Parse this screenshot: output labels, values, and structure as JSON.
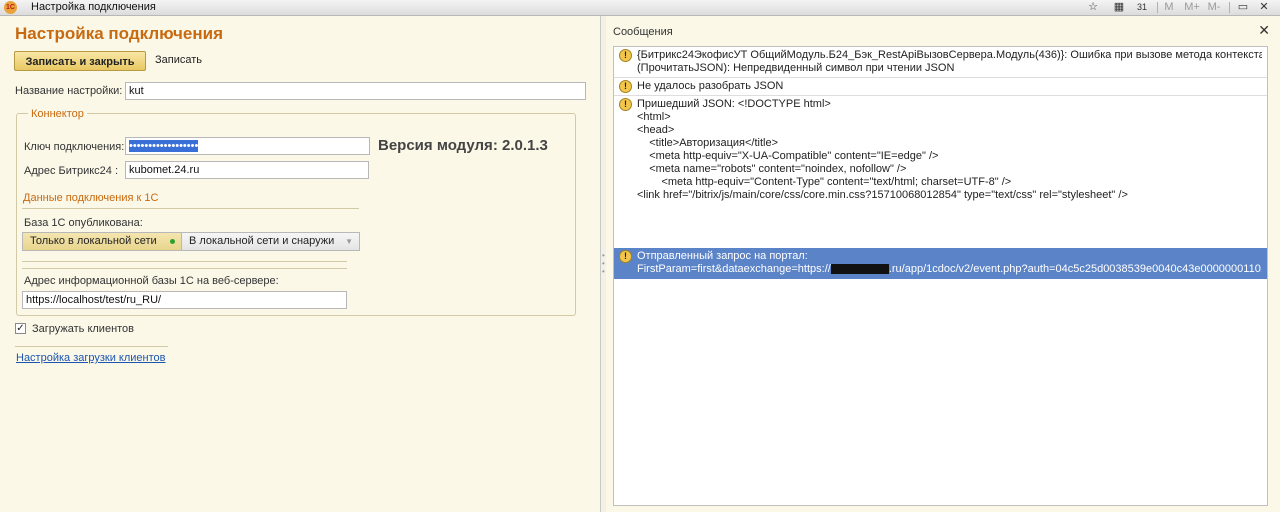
{
  "window": {
    "title": "Настройка подключения",
    "logo_text": "1С",
    "toolbar": [
      "☆",
      "▦",
      "31",
      "M",
      "M+",
      "M-",
      "▭",
      "✕"
    ]
  },
  "form": {
    "title": "Настройка подключения",
    "save_close_label": "Записать и закрыть",
    "save_label": "Записать",
    "name_label": "Название настройки:",
    "name_value": "kut",
    "connector": {
      "title": "Коннектор",
      "key_label": "Ключ подключения:",
      "key_value": "••••••••••••••••••",
      "address_label": "Адрес Битрикс24 :",
      "address_value": "kubomet.24.ru",
      "version": "Версия модуля: 2.0.1.3",
      "onec_section": "Данные подключения к 1С",
      "published_label": "База 1С опубликована:",
      "option_local": "Только в локальной сети",
      "option_both": "В локальной сети и снаружи",
      "web_address_label": "Адрес информационной базы 1С на веб-сервере:",
      "web_address_value": "https://localhost/test/ru_RU/"
    },
    "load_clients_label": "Загружать клиентов",
    "load_clients_checked": true,
    "clients_settings_link": "Настройка загрузки клиентов"
  },
  "messages": {
    "title": "Сообщения",
    "items": [
      {
        "text": "{Битрикс24ЭкофисУТ ОбщийМодуль.Б24_Бэк_RestApiВызовСервера.Модуль(436)}: Ошибка при вызове метода контекста\n(ПрочитатьJSON): Непредвиденный символ при чтении JSON"
      },
      {
        "text": "Не удалось разобрать JSON"
      },
      {
        "text": "Пришедший JSON: <!DOCTYPE html>\n<html>\n<head>\n    <title>Авторизация</title>\n    <meta http-equiv=\"X-UA-Compatible\" content=\"IE=edge\" />\n    <meta name=\"robots\" content=\"noindex, nofollow\" />\n        <meta http-equiv=\"Content-Type\" content=\"text/html; charset=UTF-8\" />\n<link href=\"/bitrix/js/main/core/css/core.min.css?15710068012854\" type=\"text/css\" rel=\"stylesheet\" />"
      },
      {
        "text_line1": "Отправленный запрос на портал:",
        "text_line2a": "FirstParam=first&dataexchange=https://",
        "text_line2b": ".ru/app/1cdoc/v2/event.php?auth=04c5c25d0038539e0040c43e0000000110..."
      }
    ]
  }
}
